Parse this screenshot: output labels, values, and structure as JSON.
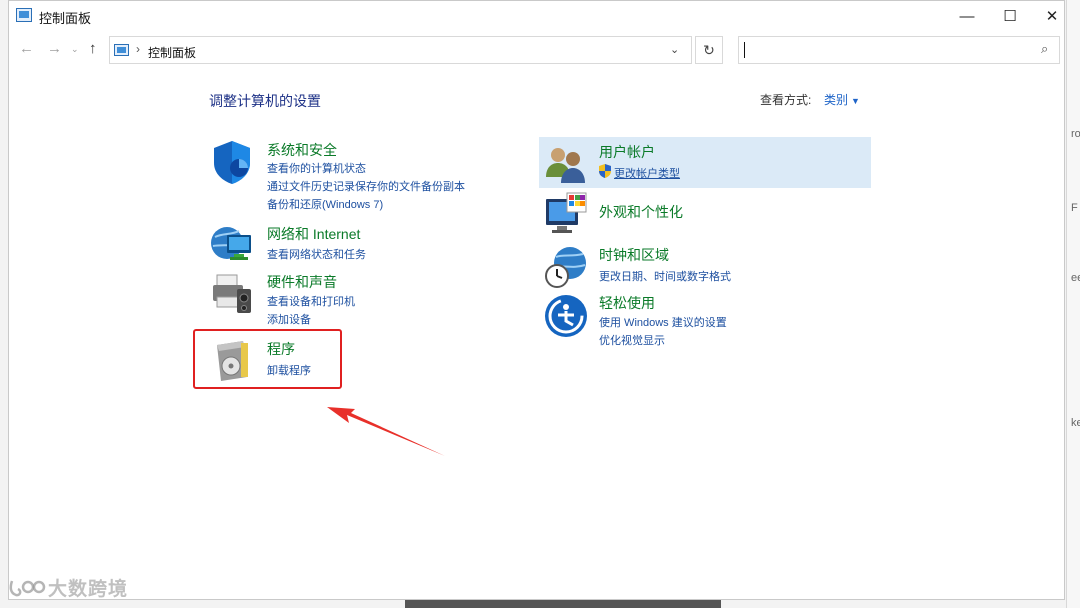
{
  "window": {
    "title": "控制面板",
    "min_glyph": "—",
    "max_glyph": "☐",
    "close_glyph": "✕"
  },
  "nav": {
    "back_glyph": "←",
    "forward_glyph": "→",
    "recent_glyph": "⌄",
    "up_glyph": "↑",
    "breadcrumb_sep": "›",
    "breadcrumb": "控制面板",
    "address_dropdown": "⌄",
    "refresh_glyph": "↻",
    "search_placeholder": "",
    "search_glyph": "⌕"
  },
  "main": {
    "heading": "调整计算机的设置",
    "view_by_label": "查看方式:",
    "view_by_value": "类别",
    "left": [
      {
        "title": "系统和安全",
        "icon": "shield-icon",
        "links": [
          "查看你的计算机状态",
          "通过文件历史记录保存你的文件备份副本",
          "备份和还原(Windows 7)"
        ]
      },
      {
        "title": "网络和 Internet",
        "icon": "network-globe-icon",
        "links": [
          "查看网络状态和任务"
        ]
      },
      {
        "title": "硬件和声音",
        "icon": "printer-speaker-icon",
        "links": [
          "查看设备和打印机",
          "添加设备"
        ]
      },
      {
        "title": "程序",
        "icon": "programs-disc-icon",
        "links": [
          "卸载程序"
        ]
      }
    ],
    "right": [
      {
        "title": "用户帐户",
        "icon": "users-icon",
        "links": [
          "更改帐户类型"
        ],
        "link_icon": "uac-shield-icon"
      },
      {
        "title": "外观和个性化",
        "icon": "monitor-palette-icon",
        "links": []
      },
      {
        "title": "时钟和区域",
        "icon": "clock-globe-icon",
        "links": [
          "更改日期、时间或数字格式"
        ]
      },
      {
        "title": "轻松使用",
        "icon": "ease-of-access-icon",
        "links": [
          "使用 Windows 建议的设置",
          "优化视觉显示"
        ]
      }
    ]
  },
  "annotation": {
    "colors": {
      "box": "#e02020",
      "arrow": "#e8302a"
    }
  },
  "edge": {
    "chars": [
      "ro",
      "F",
      "ee",
      "ke"
    ]
  },
  "watermark": {
    "text": "大数跨境"
  }
}
